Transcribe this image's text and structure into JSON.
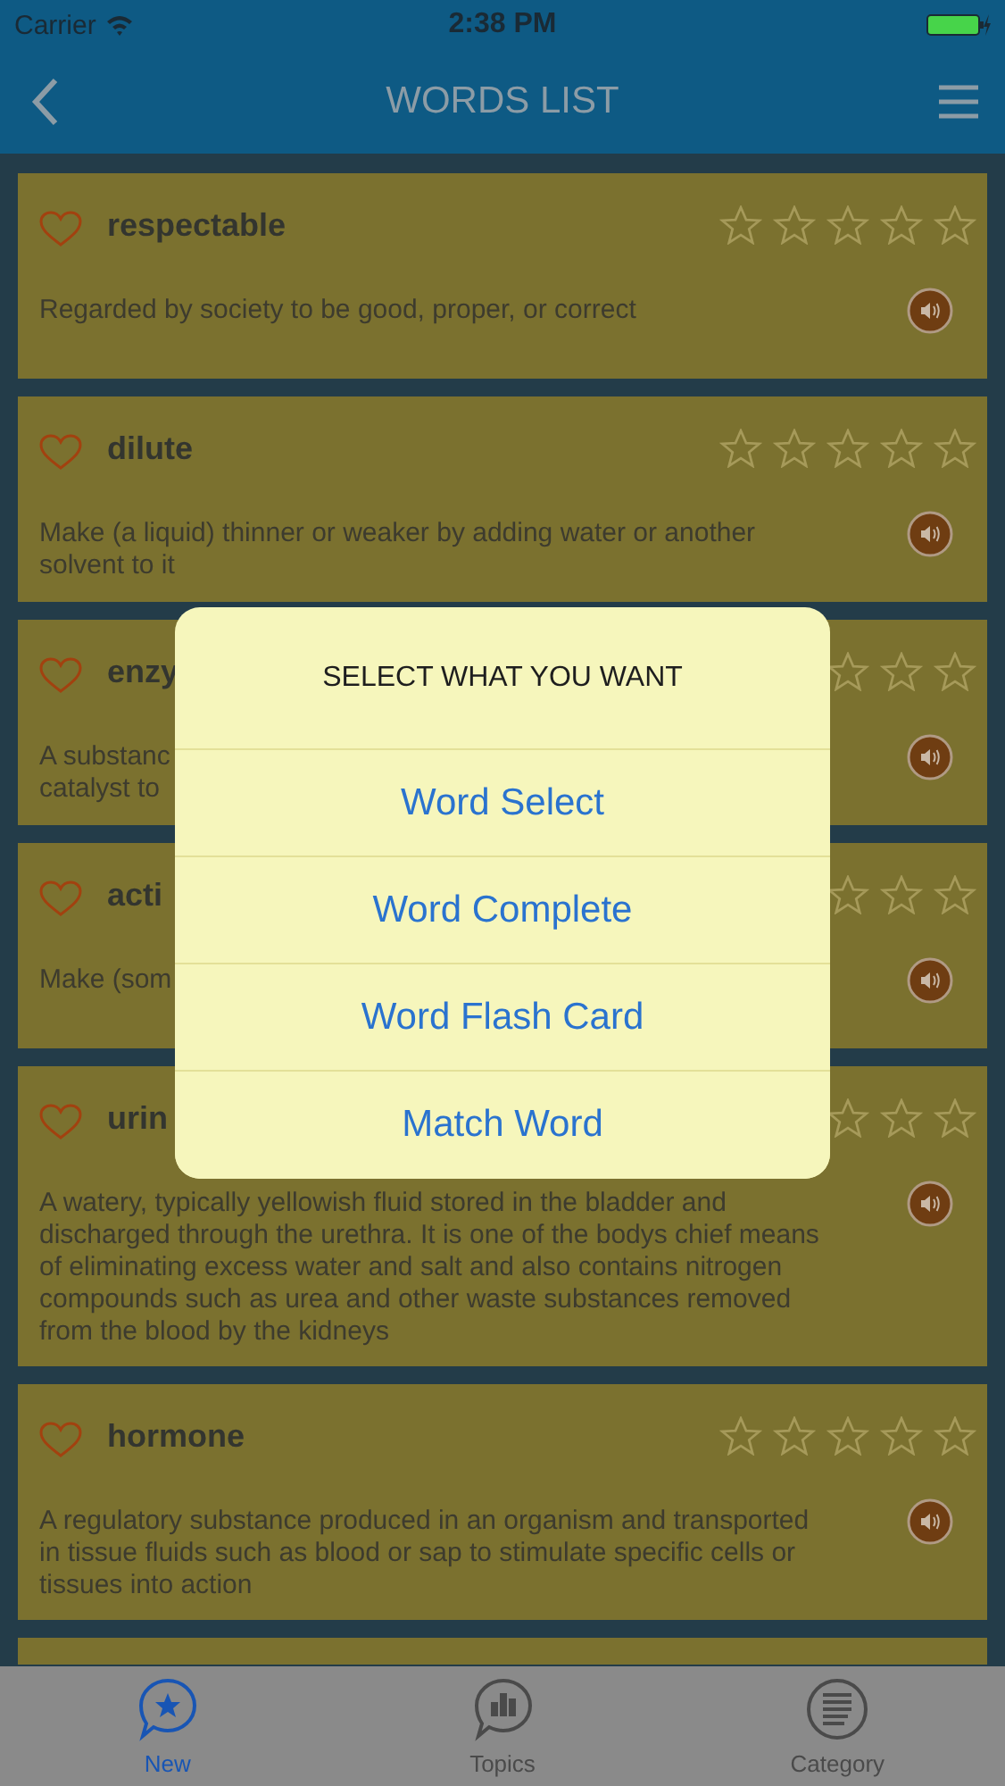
{
  "status_bar": {
    "carrier": "Carrier",
    "time": "2:38 PM"
  },
  "nav": {
    "title": "WORDS LIST"
  },
  "words": [
    {
      "word": "respectable",
      "definition": "Regarded by society to be good, proper, or correct",
      "favorite": false,
      "stars": 0
    },
    {
      "word": "dilute",
      "definition": "Make (a liquid) thinner or weaker by adding water or another solvent to it",
      "favorite": false,
      "stars": 0
    },
    {
      "word": "enzy",
      "definition": "A substanc\ncatalyst to",
      "favorite": false,
      "stars": 0
    },
    {
      "word": "acti",
      "definition": "Make (som",
      "favorite": false,
      "stars": 0
    },
    {
      "word": "urin",
      "definition": "A watery, typically yellowish fluid stored in the bladder and discharged through the urethra. It is one of the bodys chief means of eliminating excess water and salt and also contains nitrogen compounds such as urea and other waste substances removed from the blood by the kidneys",
      "favorite": false,
      "stars": 0
    },
    {
      "word": "hormone",
      "definition": "A regulatory substance produced in an organism and transported in tissue fluids such as blood or sap to stimulate specific cells or tissues into action",
      "favorite": false,
      "stars": 0
    }
  ],
  "dialog": {
    "title": "SELECT WHAT YOU WANT",
    "options": [
      "Word Select",
      "Word Complete",
      "Word Flash Card",
      "Match Word"
    ]
  },
  "tabs": [
    {
      "label": "New",
      "selected": true,
      "kind": "star"
    },
    {
      "label": "Topics",
      "selected": false,
      "kind": "bars"
    },
    {
      "label": "Category",
      "selected": false,
      "kind": "list"
    }
  ]
}
